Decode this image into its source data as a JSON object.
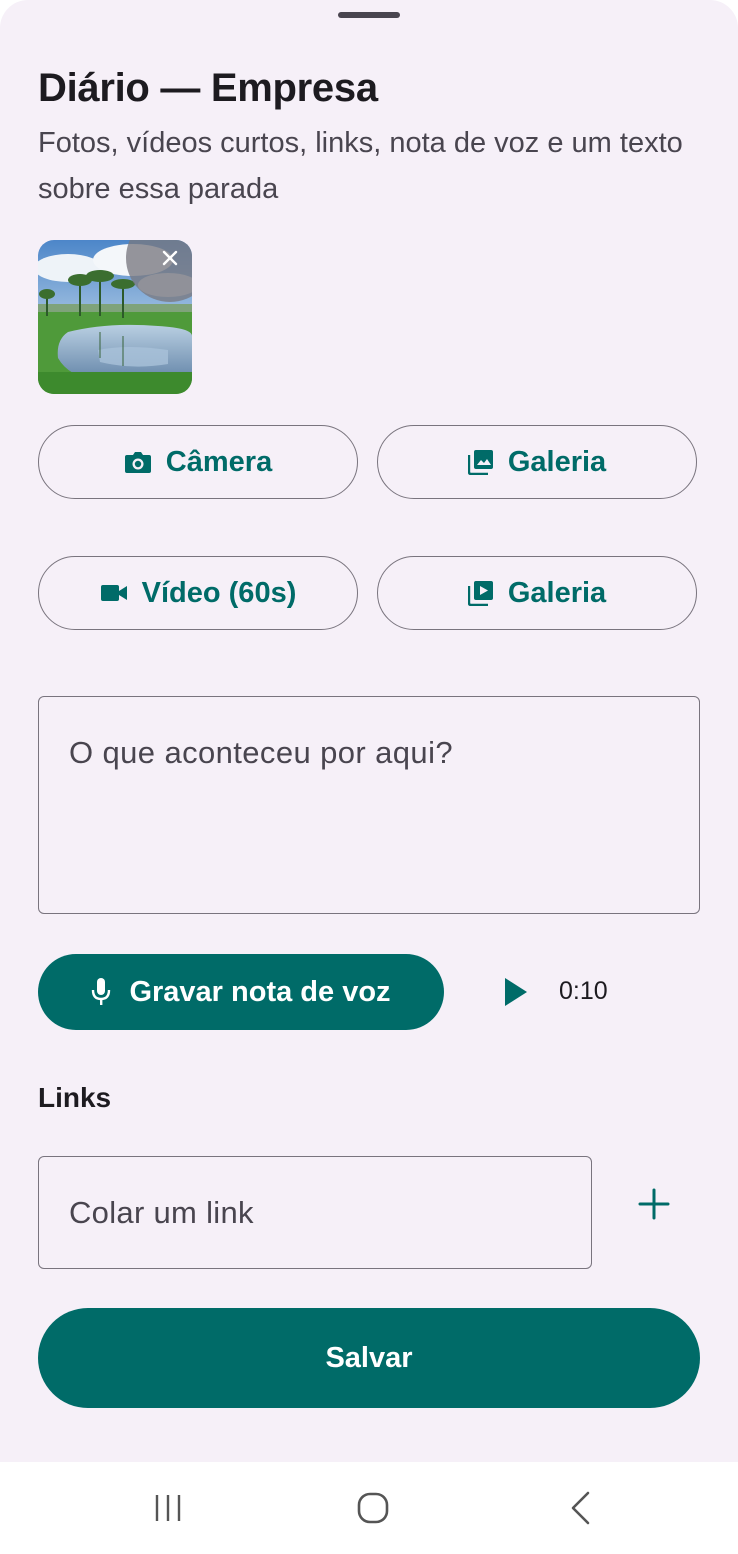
{
  "sheet": {
    "title": "Diário — Empresa",
    "subtitle": "Fotos, vídeos curtos, links, nota de voz e um texto sobre essa parada"
  },
  "media": {
    "photo_count": 1,
    "remove_icon": "close-icon"
  },
  "buttons": {
    "camera": {
      "label": "Câmera",
      "icon": "camera-icon"
    },
    "photo_gallery": {
      "label": "Galeria",
      "icon": "photo-library-icon"
    },
    "video": {
      "label": "Vídeo (60s)",
      "icon": "videocam-icon"
    },
    "video_gallery": {
      "label": "Galeria",
      "icon": "video-library-icon"
    }
  },
  "note": {
    "placeholder": "O que aconteceu por aqui?",
    "value": ""
  },
  "voice": {
    "record_label": "Gravar nota de voz",
    "record_icon": "mic-icon",
    "play_icon": "play-icon",
    "duration": "0:10"
  },
  "links": {
    "label": "Links",
    "placeholder": "Colar um link",
    "value": "",
    "add_icon": "plus-icon"
  },
  "save_label": "Salvar",
  "navbar": {
    "recent_icon": "recent-apps-icon",
    "home_icon": "home-icon",
    "back_icon": "back-icon"
  },
  "colors": {
    "accent": "#006b68",
    "sheet_background": "#f6f0f8",
    "outline": "#79747e",
    "text_primary": "#1d1b20",
    "text_secondary": "#49454f"
  }
}
